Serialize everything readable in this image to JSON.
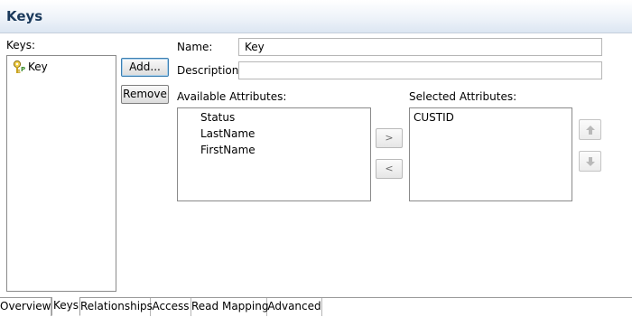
{
  "header": {
    "title": "Keys"
  },
  "keys": {
    "label": "Keys:",
    "items": [
      {
        "label": "Key",
        "icon": "key-icon"
      }
    ]
  },
  "buttons": {
    "add": "Add...",
    "remove": "Remove"
  },
  "form": {
    "name_label": "Name:",
    "name_value": "Key",
    "description_label": "Description:",
    "description_value": ""
  },
  "available": {
    "label": "Available Attributes:",
    "items": [
      "Status",
      "LastName",
      "FirstName"
    ]
  },
  "selected": {
    "label": "Selected Attributes:",
    "items": [
      "CUSTID"
    ]
  },
  "move": {
    "right": ">",
    "left": "<"
  },
  "tabs": [
    {
      "label": "Overview",
      "active": false
    },
    {
      "label": "Keys",
      "active": true
    },
    {
      "label": "Relationships",
      "active": false
    },
    {
      "label": "Access",
      "active": false
    },
    {
      "label": "Read Mapping",
      "active": false
    },
    {
      "label": "Advanced",
      "active": false
    }
  ],
  "colors": {
    "header_text": "#1b3a5c",
    "focus_border": "#3c7fb1"
  }
}
